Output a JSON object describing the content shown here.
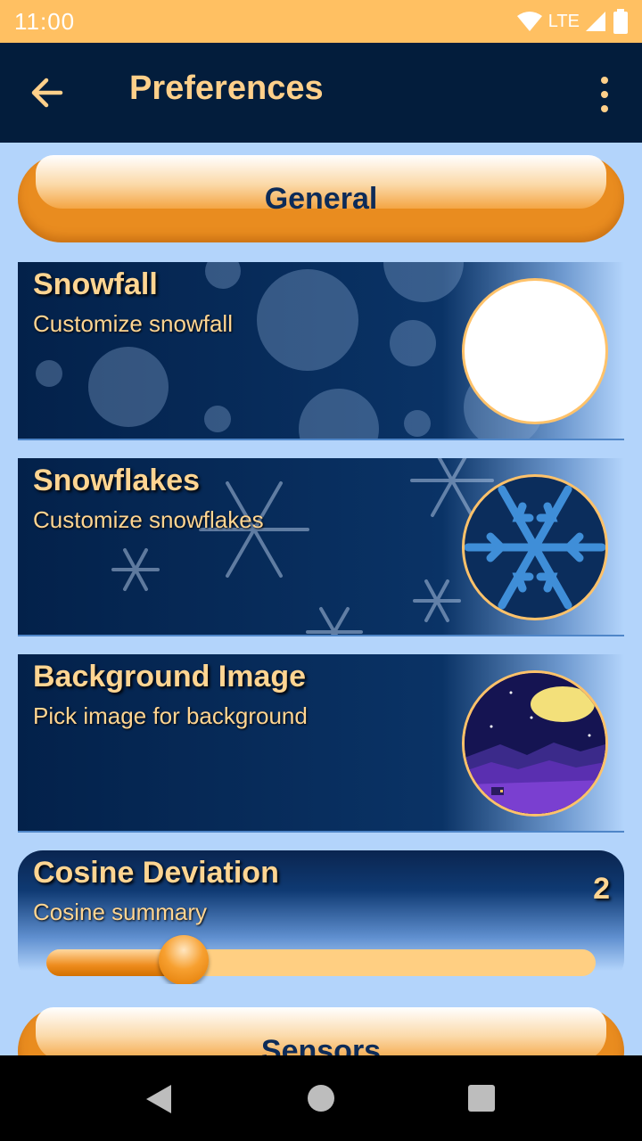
{
  "status_bar": {
    "time": "11:00",
    "network": "LTE"
  },
  "app_bar": {
    "title": "Preferences"
  },
  "sections": [
    {
      "label": "General"
    },
    {
      "label": "Sensors"
    }
  ],
  "preferences": [
    {
      "title": "Snowfall",
      "summary": "Customize snowfall"
    },
    {
      "title": "Snowflakes",
      "summary": "Customize snowflakes"
    },
    {
      "title": "Background Image",
      "summary": "Pick image for background"
    }
  ],
  "cosine": {
    "title": "Cosine Deviation",
    "summary": "Cosine summary",
    "value": "2",
    "fraction": 0.25
  },
  "colors": {
    "status_bar": "#ffc062",
    "app_bar": "#031d3c",
    "accent": "#e98c1f",
    "background": "#b3d4fb",
    "text_gold": "#ffd592"
  }
}
